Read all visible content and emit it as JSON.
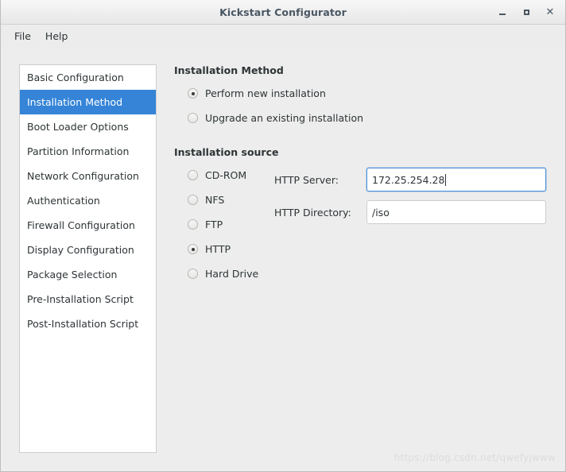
{
  "window": {
    "title": "Kickstart Configurator",
    "controls": [
      {
        "name": "minimize",
        "glyph": "minimize-icon"
      },
      {
        "name": "maximize",
        "glyph": "maximize-icon"
      },
      {
        "name": "close",
        "glyph": "close-icon",
        "label": "✕"
      }
    ]
  },
  "menubar": {
    "items": [
      {
        "label": "File"
      },
      {
        "label": "Help"
      }
    ]
  },
  "sidebar": {
    "selected_index": 1,
    "items": [
      {
        "label": "Basic Configuration"
      },
      {
        "label": "Installation Method"
      },
      {
        "label": "Boot Loader Options"
      },
      {
        "label": "Partition Information"
      },
      {
        "label": "Network Configuration"
      },
      {
        "label": "Authentication"
      },
      {
        "label": "Firewall Configuration"
      },
      {
        "label": "Display Configuration"
      },
      {
        "label": "Package Selection"
      },
      {
        "label": "Pre-Installation Script"
      },
      {
        "label": "Post-Installation Script"
      }
    ]
  },
  "main": {
    "method": {
      "heading": "Installation Method",
      "options": [
        {
          "label": "Perform new installation",
          "selected": true
        },
        {
          "label": "Upgrade an existing installation",
          "selected": false
        }
      ]
    },
    "source": {
      "heading": "Installation source",
      "options": [
        {
          "label": "CD-ROM",
          "selected": false
        },
        {
          "label": "NFS",
          "selected": false
        },
        {
          "label": "FTP",
          "selected": false
        },
        {
          "label": "HTTP",
          "selected": true
        },
        {
          "label": "Hard Drive",
          "selected": false
        }
      ],
      "fields": [
        {
          "label": "HTTP Server:",
          "value": "172.25.254.28",
          "placeholder": "",
          "focused": true
        },
        {
          "label": "HTTP Directory:",
          "value": "/iso",
          "placeholder": "",
          "focused": false
        }
      ]
    }
  },
  "watermark": {
    "text": "https://blog.csdn.net/qwefyjwww"
  },
  "colors": {
    "accent": "#3584d7",
    "focus_border": "#4a90d9",
    "window_bg": "#ededed",
    "list_bg": "#ffffff",
    "text": "#2e3436",
    "title_text": "#4a5763"
  }
}
